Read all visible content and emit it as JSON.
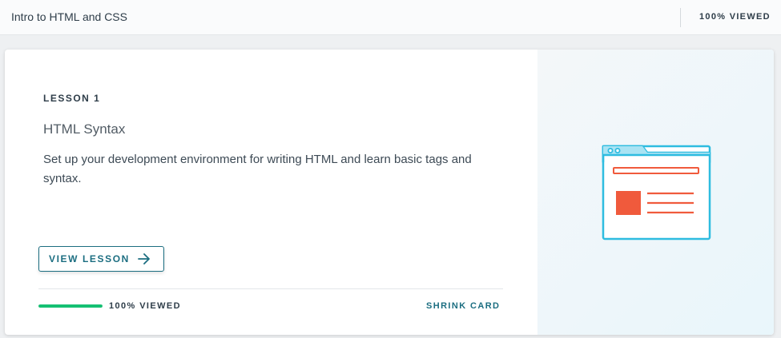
{
  "header": {
    "course_title": "Intro to HTML and CSS",
    "viewed_label": "100% VIEWED"
  },
  "card": {
    "lesson_label": "LESSON 1",
    "title": "HTML Syntax",
    "description": "Set up your development environment for writing HTML and learn basic tags and syntax.",
    "view_button_label": "VIEW LESSON",
    "progress": {
      "fraction": 1.0,
      "label": "100% VIEWED"
    },
    "shrink_label": "SHRINK CARD",
    "illustration_icon": "browser-window-icon"
  },
  "colors": {
    "accent": "#1c6e81",
    "progress": "#16c073",
    "illustration_frame": "#2ebce0",
    "illustration_content": "#f05a3c"
  }
}
